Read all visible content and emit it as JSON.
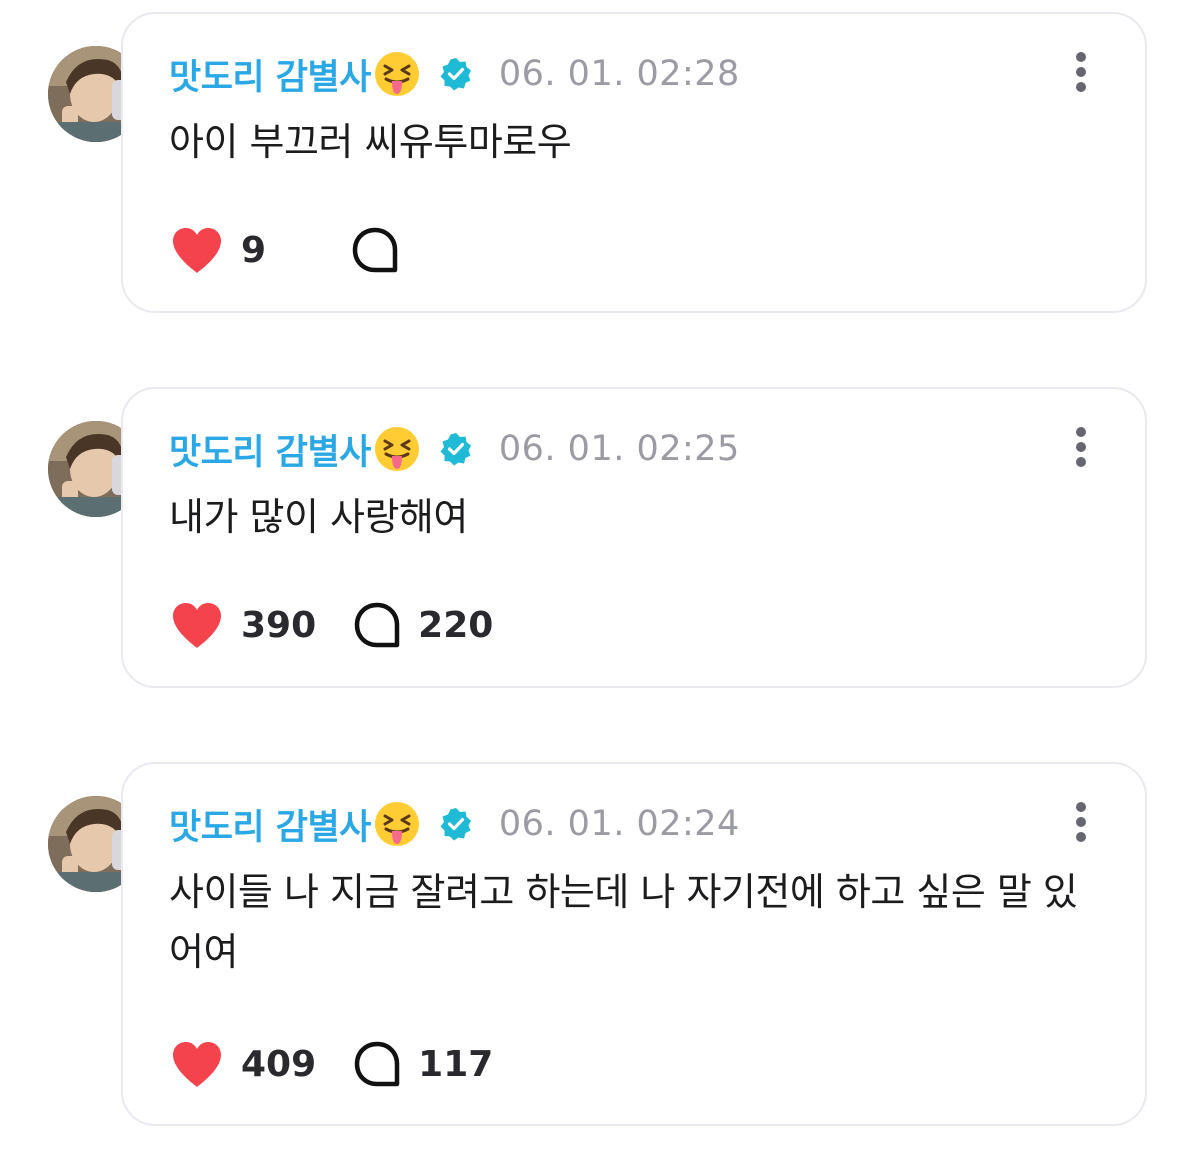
{
  "posts": [
    {
      "author": "맛도리 감별사",
      "emoji_icon": "squinting-face-with-tongue-icon",
      "verified_icon": "verified-badge-icon",
      "timestamp": "06. 01. 02:28",
      "text": "아이 부끄러 씨유투마로우",
      "likes": "9",
      "comments": ""
    },
    {
      "author": "맛도리 감별사",
      "emoji_icon": "squinting-face-with-tongue-icon",
      "verified_icon": "verified-badge-icon",
      "timestamp": "06. 01. 02:25",
      "text": "내가 많이 사랑해여",
      "likes": "390",
      "comments": "220"
    },
    {
      "author": "맛도리 감별사",
      "emoji_icon": "squinting-face-with-tongue-icon",
      "verified_icon": "verified-badge-icon",
      "timestamp": "06. 01. 02:24",
      "text": "사이들 나 지금 잘려고 하는데 나 자기전에 하고 싶은 말 있어여",
      "likes": "409",
      "comments": "117"
    }
  ],
  "colors": {
    "username": "#2aa8e6",
    "verified": "#1fbad6",
    "like": "#f5434e",
    "timestamp": "#9b9ba3",
    "card_border": "#e9e9ef"
  }
}
